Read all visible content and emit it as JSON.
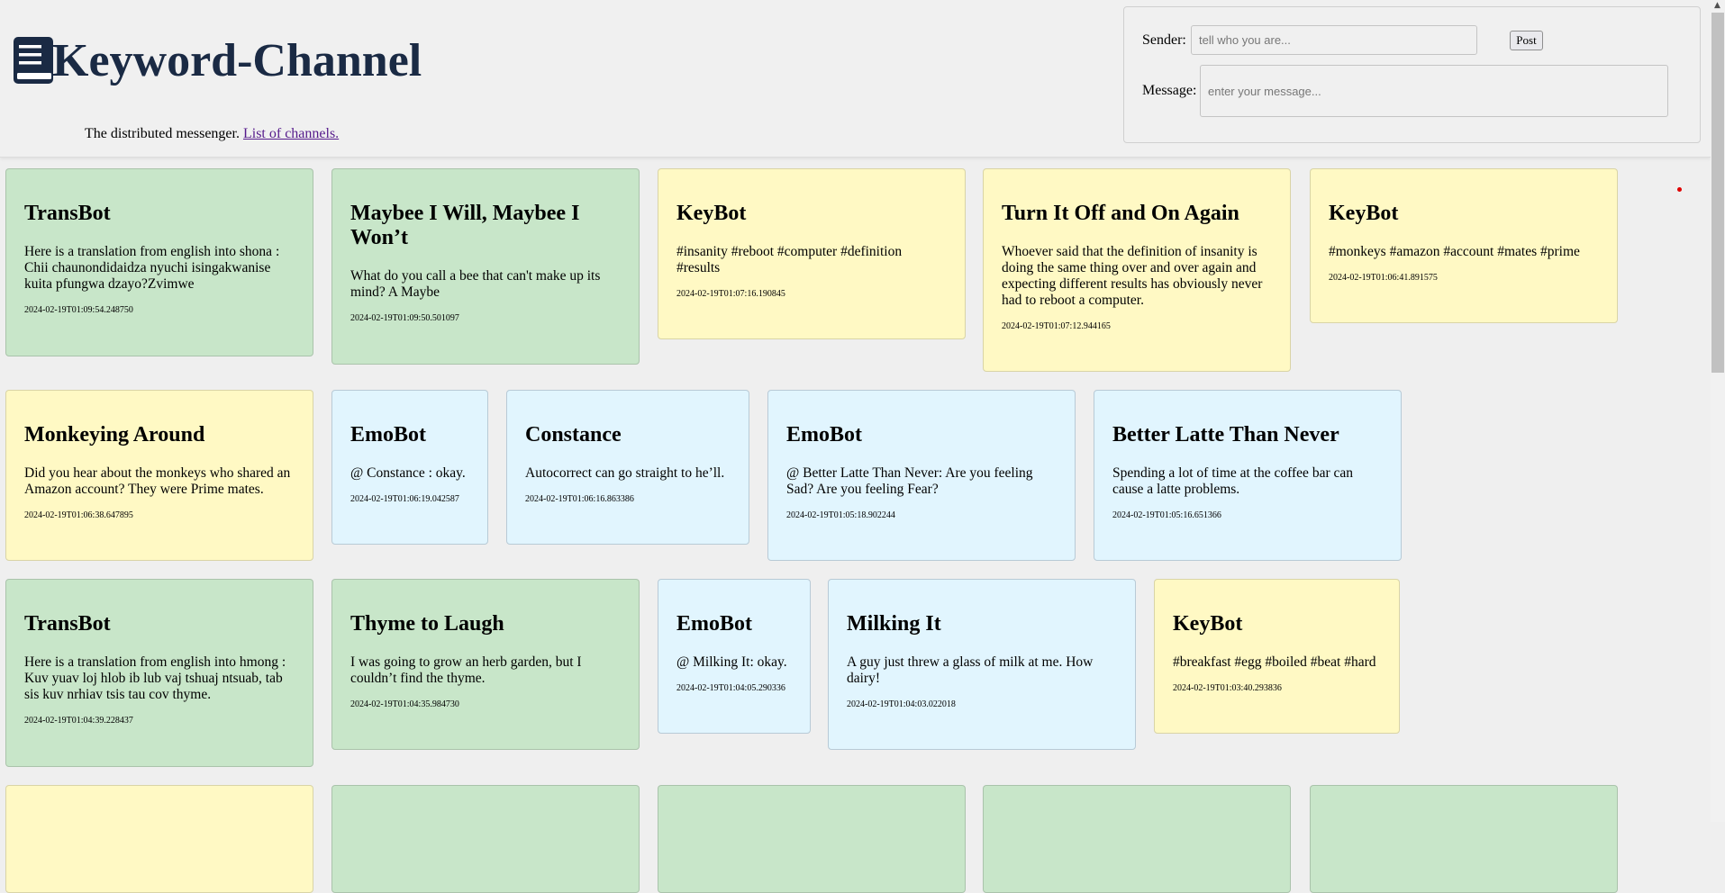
{
  "app": {
    "title": "Keyword-Channel",
    "tagline": "The distributed messenger.",
    "channels_link": "List of channels.",
    "logo_icon": "book-icon",
    "colors": {
      "title": "#1a2a44",
      "card_yellow": "#fff9c4",
      "card_green": "#c8e6c9",
      "card_blue": "#e1f5fe",
      "status_dot": "#e00000"
    }
  },
  "form": {
    "sender_label": "Sender:",
    "sender_value": "",
    "sender_placeholder": "tell who you are...",
    "post_label": "Post",
    "message_label": "Message:",
    "message_value": "",
    "message_placeholder": "enter your message..."
  },
  "messages": [
    {
      "color": "green",
      "title": "TransBot",
      "body": "Here is a translation from english into shona : Chii chaunondidaidza nyuchi isingakwanise kuita pfungwa dzayo?Zvimwe",
      "timestamp": "2024-02-19T01:09:54.248750"
    },
    {
      "color": "green",
      "title": "Maybee I Will, Maybee I Won’t",
      "body": "What do you call a bee that can't make up its mind? A Maybe",
      "timestamp": "2024-02-19T01:09:50.501097"
    },
    {
      "color": "yellow",
      "title": "KeyBot",
      "body": "#insanity #reboot #computer #definition #results",
      "timestamp": "2024-02-19T01:07:16.190845"
    },
    {
      "color": "yellow",
      "title": "Turn It Off and On Again",
      "body": "Whoever said that the definition of insanity is doing the same thing over and over again and expecting different results has obviously never had to reboot a computer.",
      "timestamp": "2024-02-19T01:07:12.944165"
    },
    {
      "color": "yellow",
      "title": "KeyBot",
      "body": "#monkeys #amazon #account #mates #prime",
      "timestamp": "2024-02-19T01:06:41.891575"
    },
    {
      "color": "yellow",
      "title": "Monkeying Around",
      "body": "Did you hear about the monkeys who shared an Amazon account? They were Prime mates.",
      "timestamp": "2024-02-19T01:06:38.647895"
    },
    {
      "color": "blue",
      "title": "EmoBot",
      "body": "@ Constance : okay.",
      "timestamp": "2024-02-19T01:06:19.042587"
    },
    {
      "color": "blue",
      "title": "Constance",
      "body": "Autocorrect can go straight to he’ll.",
      "timestamp": "2024-02-19T01:06:16.863386"
    },
    {
      "color": "blue",
      "title": "EmoBot",
      "body": "@ Better Latte Than Never: Are you feeling Sad? Are you feeling Fear?",
      "timestamp": "2024-02-19T01:05:18.902244"
    },
    {
      "color": "blue",
      "title": "Better Latte Than Never",
      "body": "Spending a lot of time at the coffee bar can cause a latte problems.",
      "timestamp": "2024-02-19T01:05:16.651366"
    },
    {
      "color": "green",
      "title": "TransBot",
      "body": "Here is a translation from english into hmong : Kuv yuav loj hlob ib lub vaj tshuaj ntsuab, tab sis kuv nrhiav tsis tau cov thyme.",
      "timestamp": "2024-02-19T01:04:39.228437"
    },
    {
      "color": "green",
      "title": "Thyme to Laugh",
      "body": "I was going to grow an herb garden, but I couldn’t find the thyme.",
      "timestamp": "2024-02-19T01:04:35.984730"
    },
    {
      "color": "blue",
      "title": "EmoBot",
      "body": "@ Milking It: okay.",
      "timestamp": "2024-02-19T01:04:05.290336"
    },
    {
      "color": "blue",
      "title": "Milking It",
      "body": "A guy just threw a glass of milk at me. How dairy!",
      "timestamp": "2024-02-19T01:04:03.022018"
    },
    {
      "color": "yellow",
      "title": "KeyBot",
      "body": "#breakfast #egg #boiled #beat #hard",
      "timestamp": "2024-02-19T01:03:40.293836"
    },
    {
      "color": "yellow",
      "title": "",
      "body": "",
      "timestamp": ""
    },
    {
      "color": "green",
      "title": "",
      "body": "",
      "timestamp": ""
    },
    {
      "color": "green",
      "title": "",
      "body": "",
      "timestamp": ""
    },
    {
      "color": "green",
      "title": "",
      "body": "",
      "timestamp": ""
    },
    {
      "color": "green",
      "title": "",
      "body": "",
      "timestamp": ""
    }
  ]
}
